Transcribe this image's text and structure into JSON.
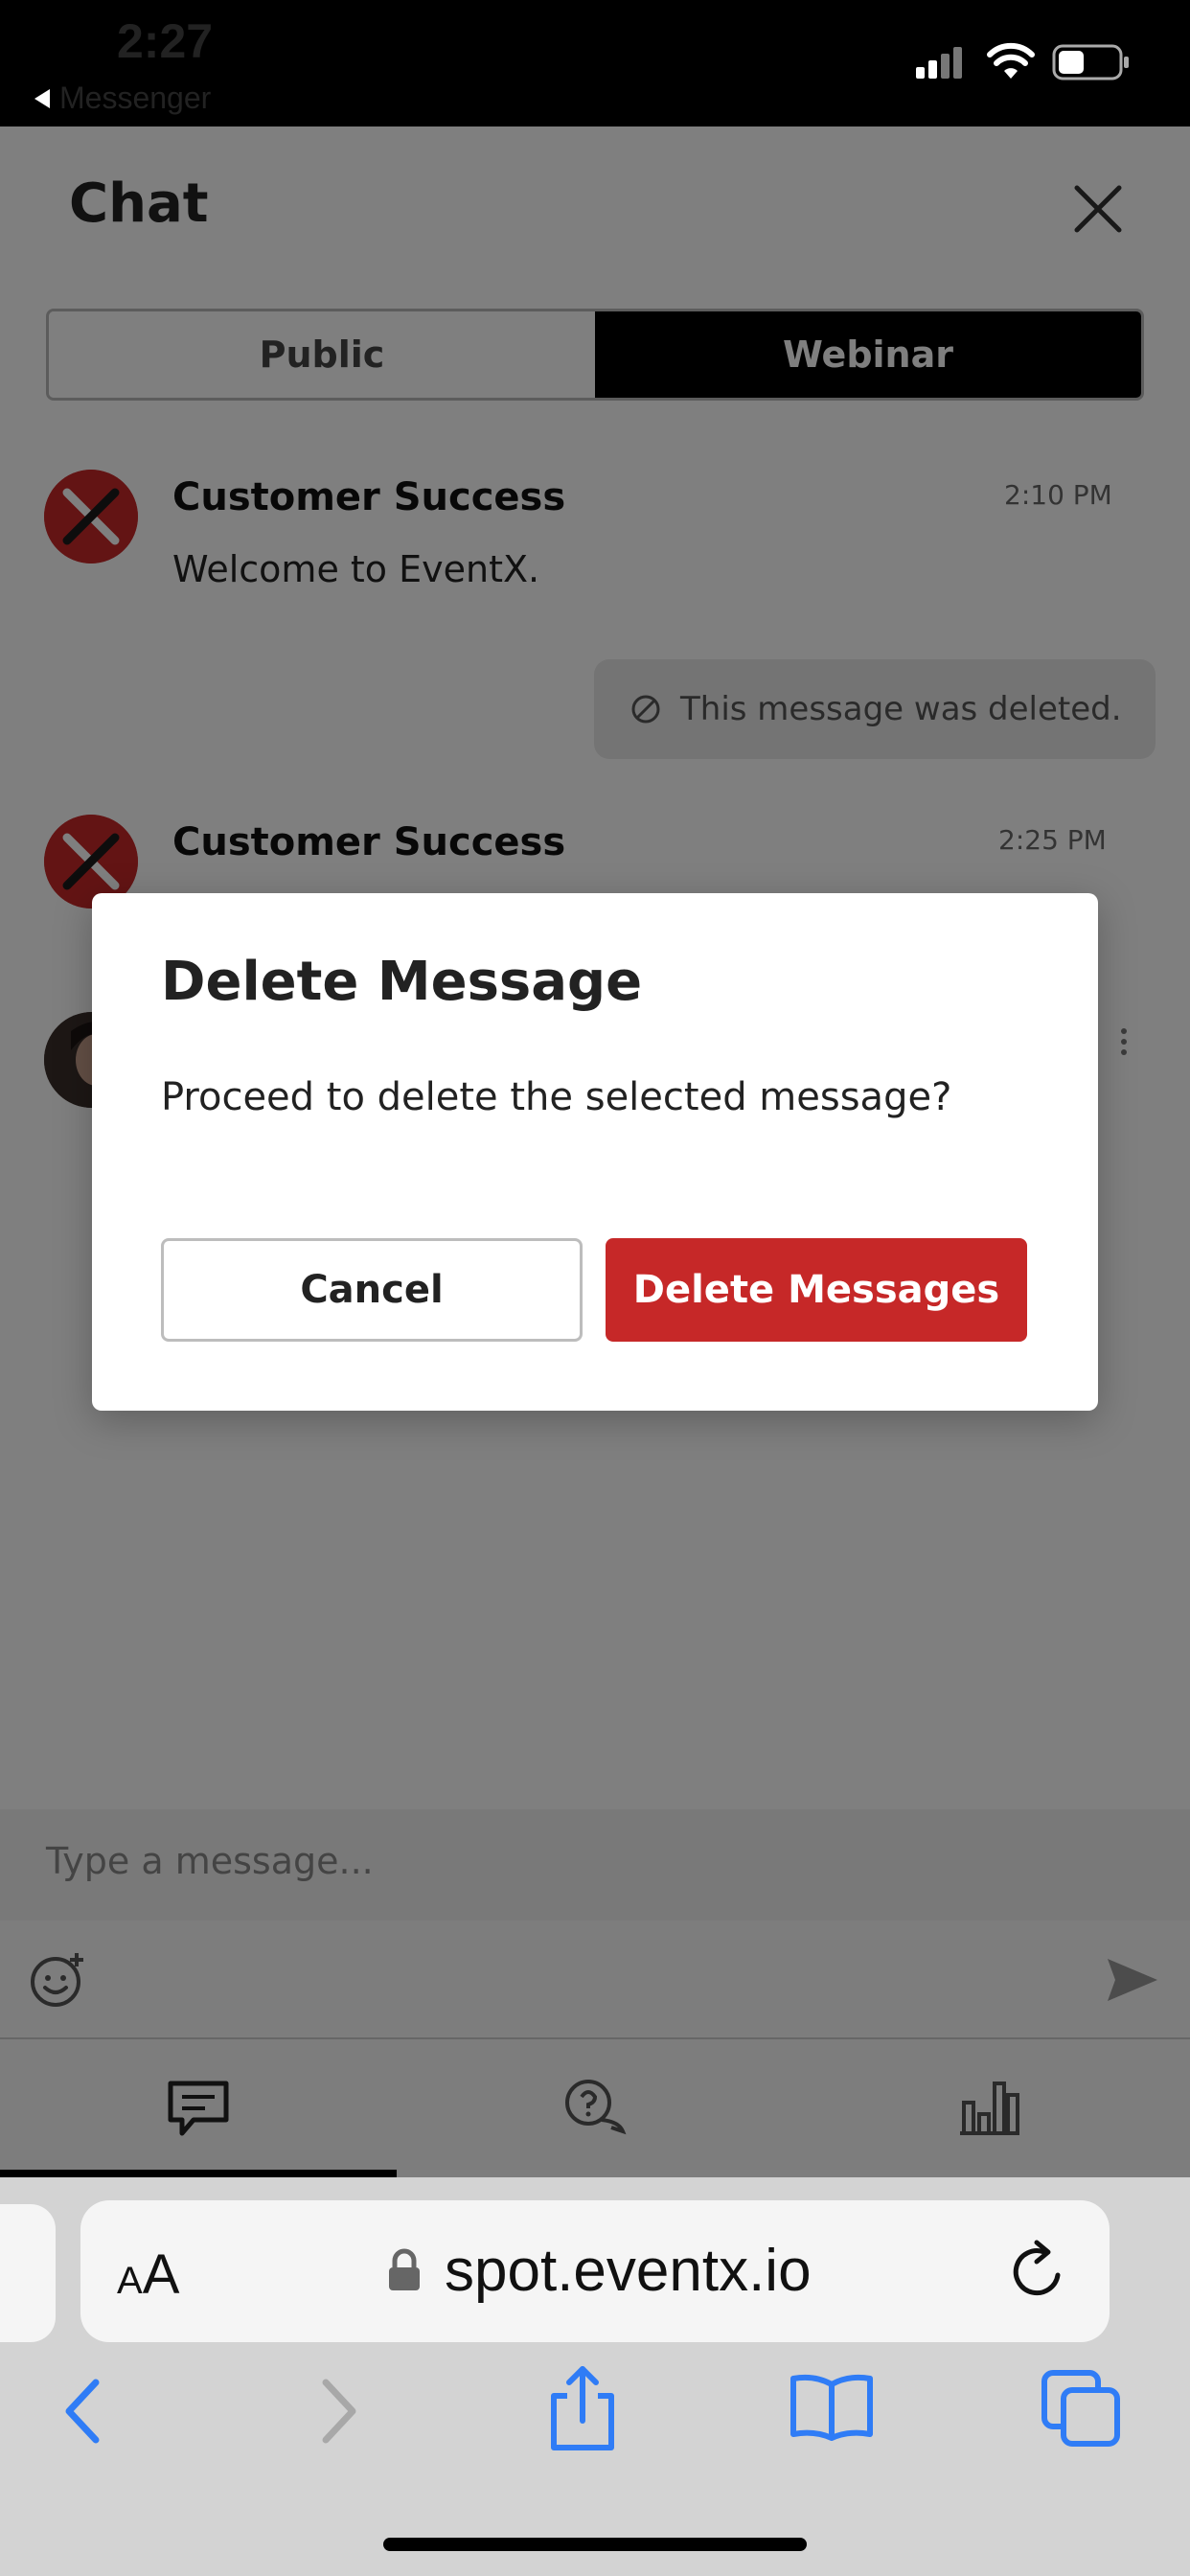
{
  "status_bar": {
    "time": "2:27",
    "back_app": "Messenger"
  },
  "chat": {
    "title": "Chat",
    "tabs": [
      {
        "label": "Public",
        "active": false
      },
      {
        "label": "Webinar",
        "active": true
      }
    ],
    "messages": [
      {
        "sender": "Customer Success",
        "text": "Welcome to EventX.",
        "time": "2:10 PM"
      },
      {
        "deleted_text": "This message was deleted."
      },
      {
        "sender": "Customer Success",
        "time": "2:25 PM"
      }
    ],
    "input_placeholder": "Type a message..."
  },
  "dialog": {
    "title": "Delete Message",
    "body": "Proceed to delete the selected message?",
    "cancel_label": "Cancel",
    "confirm_label": "Delete Messages"
  },
  "browser": {
    "text_size_label_small": "A",
    "text_size_label_large": "A",
    "url": "spot.eventx.io"
  },
  "colors": {
    "accent_red": "#c62828",
    "safari_blue": "#2f7cf6"
  }
}
